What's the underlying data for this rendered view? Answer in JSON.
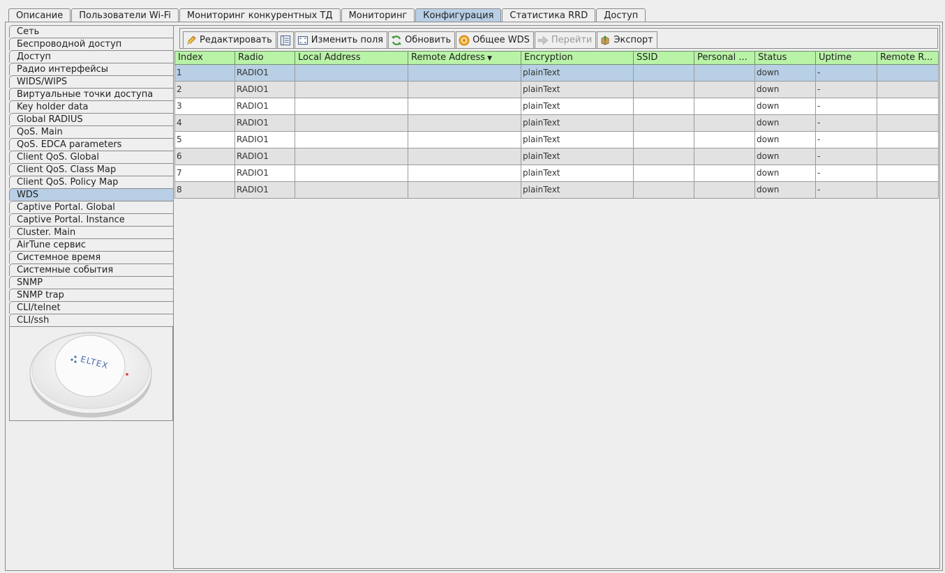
{
  "tabs": [
    {
      "label": "Описание",
      "active": false
    },
    {
      "label": "Пользователи Wi-Fi",
      "active": false
    },
    {
      "label": "Мониторинг конкурентных ТД",
      "active": false
    },
    {
      "label": "Мониторинг",
      "active": false
    },
    {
      "label": "Конфигурация",
      "active": true
    },
    {
      "label": "Статистика RRD",
      "active": false
    },
    {
      "label": "Доступ",
      "active": false
    }
  ],
  "sidebar": {
    "items": [
      {
        "label": "Сеть"
      },
      {
        "label": "Беспроводной доступ"
      },
      {
        "label": "Доступ"
      },
      {
        "label": "Радио интерфейсы"
      },
      {
        "label": "WIDS/WIPS"
      },
      {
        "label": "Виртуальные точки доступа"
      },
      {
        "label": "Key holder data"
      },
      {
        "label": "Global RADIUS"
      },
      {
        "label": "QoS. Main"
      },
      {
        "label": "QoS. EDCA parameters"
      },
      {
        "label": "Client QoS. Global"
      },
      {
        "label": "Client QoS. Class Map"
      },
      {
        "label": "Client QoS. Policy Map"
      },
      {
        "label": "WDS",
        "active": true
      },
      {
        "label": "Captive Portal. Global"
      },
      {
        "label": "Captive Portal. Instance"
      },
      {
        "label": "Cluster. Main"
      },
      {
        "label": "AirTune сервис"
      },
      {
        "label": "Системное время"
      },
      {
        "label": "Системные события"
      },
      {
        "label": "SNMP"
      },
      {
        "label": "SNMP trap"
      },
      {
        "label": "CLI/telnet"
      },
      {
        "label": "CLI/ssh"
      }
    ],
    "device_logo_text": "ELTEX"
  },
  "toolbar": {
    "edit_label": "Редактировать",
    "change_fields_label": "Изменить поля",
    "refresh_label": "Обновить",
    "general_wds_label": "Общее WDS",
    "goto_label": "Перейти",
    "export_label": "Экспорт"
  },
  "table": {
    "columns": [
      {
        "label": "Index"
      },
      {
        "label": "Radio"
      },
      {
        "label": "Local Address"
      },
      {
        "label": "Remote Address",
        "sorted": true
      },
      {
        "label": "Encryption"
      },
      {
        "label": "SSID"
      },
      {
        "label": "Personal ..."
      },
      {
        "label": "Status"
      },
      {
        "label": "Uptime"
      },
      {
        "label": "Remote R..."
      }
    ],
    "rows": [
      [
        "1",
        "RADIO1",
        "",
        "",
        "plainText",
        "",
        "",
        "down",
        "-",
        ""
      ],
      [
        "2",
        "RADIO1",
        "",
        "",
        "plainText",
        "",
        "",
        "down",
        "-",
        ""
      ],
      [
        "3",
        "RADIO1",
        "",
        "",
        "plainText",
        "",
        "",
        "down",
        "-",
        ""
      ],
      [
        "4",
        "RADIO1",
        "",
        "",
        "plainText",
        "",
        "",
        "down",
        "-",
        ""
      ],
      [
        "5",
        "RADIO1",
        "",
        "",
        "plainText",
        "",
        "",
        "down",
        "-",
        ""
      ],
      [
        "6",
        "RADIO1",
        "",
        "",
        "plainText",
        "",
        "",
        "down",
        "-",
        ""
      ],
      [
        "7",
        "RADIO1",
        "",
        "",
        "plainText",
        "",
        "",
        "down",
        "-",
        ""
      ],
      [
        "8",
        "RADIO1",
        "",
        "",
        "plainText",
        "",
        "",
        "down",
        "-",
        ""
      ]
    ],
    "selected_row": 0
  }
}
